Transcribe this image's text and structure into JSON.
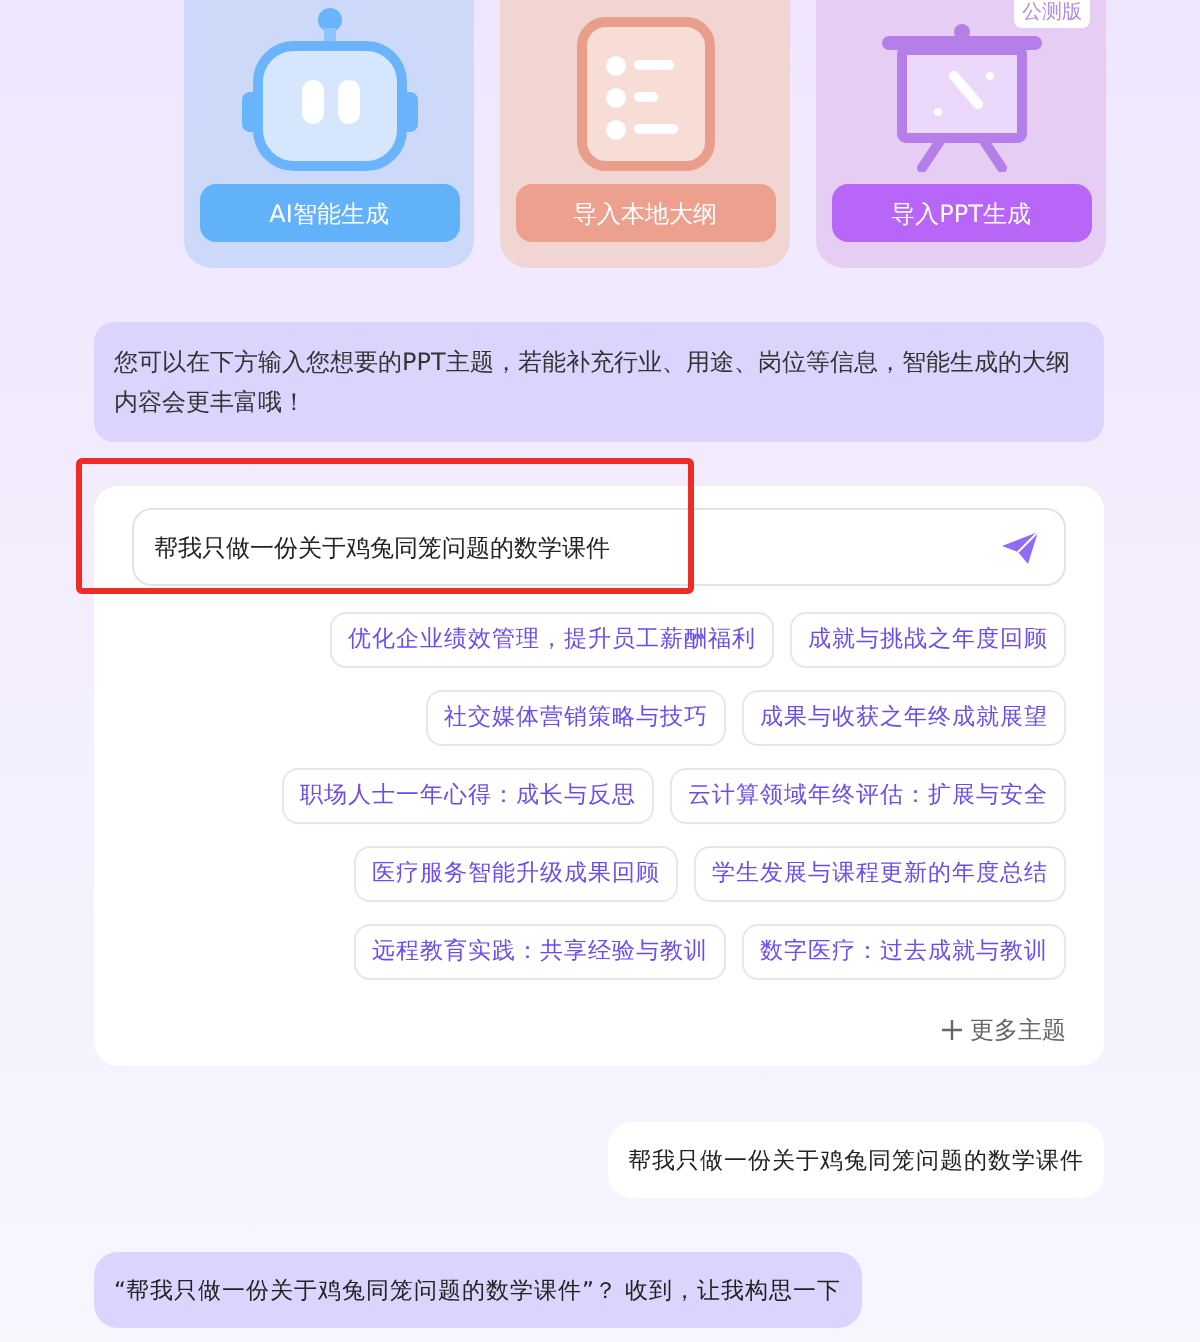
{
  "modes": [
    {
      "kind": "robot",
      "label": "AI智能生成"
    },
    {
      "kind": "outline",
      "label": "导入本地大纲"
    },
    {
      "kind": "presentation",
      "label": "导入PPT生成",
      "badge": "公测版"
    }
  ],
  "intro": "您可以在下方输入您想要的PPT主题，若能补充行业、用途、岗位等信息，智能生成的大纲内容会更丰富哦！",
  "prompt_input": {
    "value": "帮我只做一份关于鸡兔同笼问题的数学课件"
  },
  "suggestion_rows": [
    [
      "优化企业绩效管理，提升员工薪酬福利",
      "成就与挑战之年度回顾"
    ],
    [
      "社交媒体营销策略与技巧",
      "成果与收获之年终成就展望"
    ],
    [
      "职场人士一年心得：成长与反思",
      "云计算领域年终评估：扩展与安全"
    ],
    [
      "医疗服务智能升级成果回顾",
      "学生发展与课程更新的年度总结"
    ],
    [
      "远程教育实践：共享经验与教训",
      "数字医疗：过去成就与教训"
    ]
  ],
  "more_topics": "更多主题",
  "messages": [
    {
      "kind": "outgoing",
      "text": "帮我只做一份关于鸡兔同笼问题的数学课件"
    },
    {
      "kind": "incoming",
      "text": "“帮我只做一份关于鸡兔同笼问题的数学课件”？ 收到，让我构思一下"
    }
  ]
}
